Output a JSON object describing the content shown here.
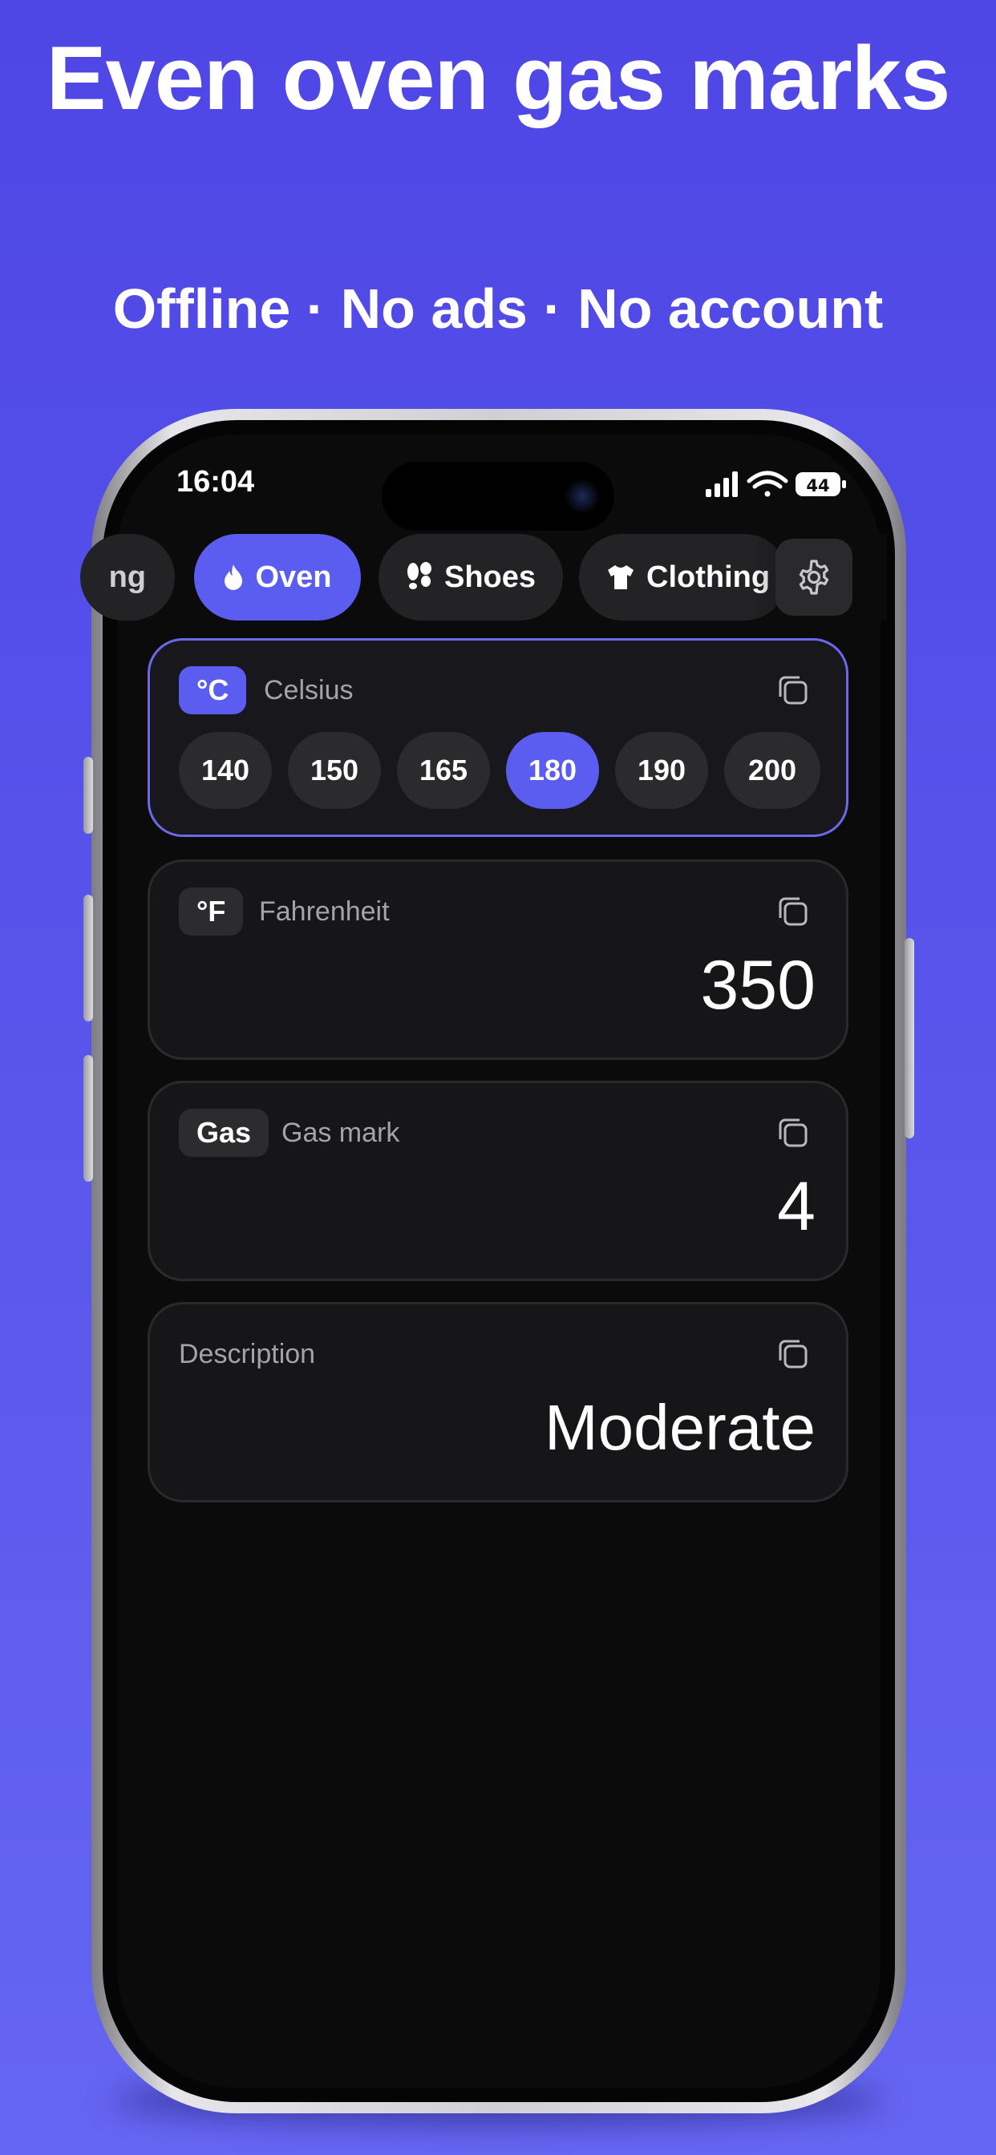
{
  "promo": {
    "headline": "Even oven gas marks",
    "subline": "Offline · No ads · No account"
  },
  "status_bar": {
    "time": "16:04",
    "battery": "44",
    "icons": [
      "cellular-signal-icon",
      "wifi-icon",
      "battery-icon"
    ]
  },
  "tabs": [
    {
      "label": "ng",
      "icon": "",
      "active": false
    },
    {
      "label": "Oven",
      "icon": "flame-icon",
      "active": true
    },
    {
      "label": "Shoes",
      "icon": "footprints-icon",
      "active": false
    },
    {
      "label": "Clothing",
      "icon": "tshirt-icon",
      "active": false
    }
  ],
  "settings": {
    "icon": "gear-icon"
  },
  "cards": {
    "celsius": {
      "badge": "°C",
      "label": "Celsius",
      "chips": [
        "140",
        "150",
        "165",
        "180",
        "190",
        "200"
      ],
      "selected_chip": "180"
    },
    "fahrenheit": {
      "badge": "°F",
      "label": "Fahrenheit",
      "value": "350"
    },
    "gas": {
      "badge": "Gas",
      "label": "Gas mark",
      "value": "4"
    },
    "description": {
      "label": "Description",
      "value": "Moderate"
    }
  },
  "colors": {
    "background": "#5152e8",
    "accent": "#5b5cf0",
    "screen": "#0b0b0c",
    "card": "#161618",
    "selected_border": "#6b68ea"
  }
}
